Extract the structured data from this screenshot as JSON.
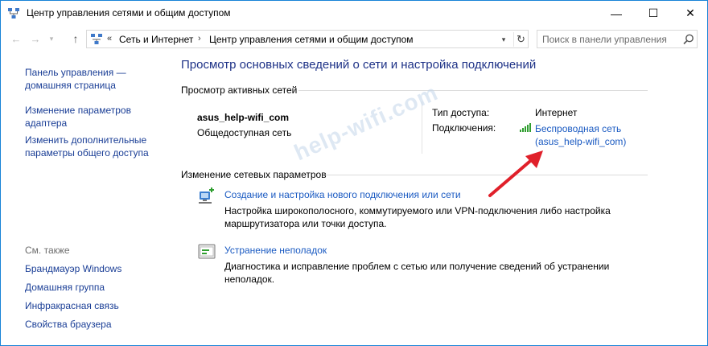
{
  "window": {
    "title": "Центр управления сетями и общим доступом",
    "minimize_glyph": "—",
    "maximize_glyph": "☐",
    "close_glyph": "✕"
  },
  "nav": {
    "back_glyph": "←",
    "forward_glyph": "→",
    "recent_glyph": "▾",
    "up_glyph": "↑",
    "address": {
      "chevron": "«",
      "separator": "›",
      "segments": [
        "Сеть и Интернет",
        "Центр управления сетями и общим доступом"
      ],
      "dropdown_glyph": "▾",
      "refresh_glyph": "↻"
    },
    "search": {
      "placeholder": "Поиск в панели управления",
      "icon": "search-icon"
    }
  },
  "sidebar": {
    "links": [
      {
        "label_lines": [
          "Панель управления —",
          "домашняя страница"
        ]
      },
      {
        "label_lines": [
          "Изменение параметров",
          "адаптера"
        ]
      },
      {
        "label_lines": [
          "Изменить дополнительные",
          "параметры общего доступа"
        ]
      }
    ],
    "see_also": {
      "heading": "См. также",
      "items": [
        "Брандмауэр Windows",
        "Домашняя группа",
        "Инфракрасная связь",
        "Свойства браузера"
      ]
    }
  },
  "main": {
    "title": "Просмотр основных сведений о сети и настройка подключений",
    "active_networks": {
      "heading": "Просмотр активных сетей",
      "network_name": "asus_help-wifi_com",
      "network_type": "Общедоступная сеть",
      "access_type_label": "Тип доступа:",
      "access_type_value": "Интернет",
      "connections_label": "Подключения:",
      "connection_link_lines": [
        "Беспроводная сеть",
        "(asus_help-wifi_com)"
      ]
    },
    "change_settings": {
      "heading": "Изменение сетевых параметров",
      "tasks": [
        {
          "link": "Создание и настройка нового подключения или сети",
          "desc_lines": [
            "Настройка широкополосного, коммутируемого или VPN-подключения либо настройка",
            "маршрутизатора или точки доступа."
          ],
          "icon": "new-connection-icon"
        },
        {
          "link": "Устранение неполадок",
          "desc_lines": [
            "Диагностика и исправление проблем с сетью или получение сведений об устранении",
            "неполадок."
          ],
          "icon": "troubleshoot-icon"
        }
      ]
    }
  },
  "watermark": "help-wifi.com",
  "colors": {
    "link": "#1a5ac2",
    "sidebar_link": "#1a3e96",
    "title": "#1e3287",
    "arrow": "#e0202a",
    "window_border": "#1883d7"
  }
}
